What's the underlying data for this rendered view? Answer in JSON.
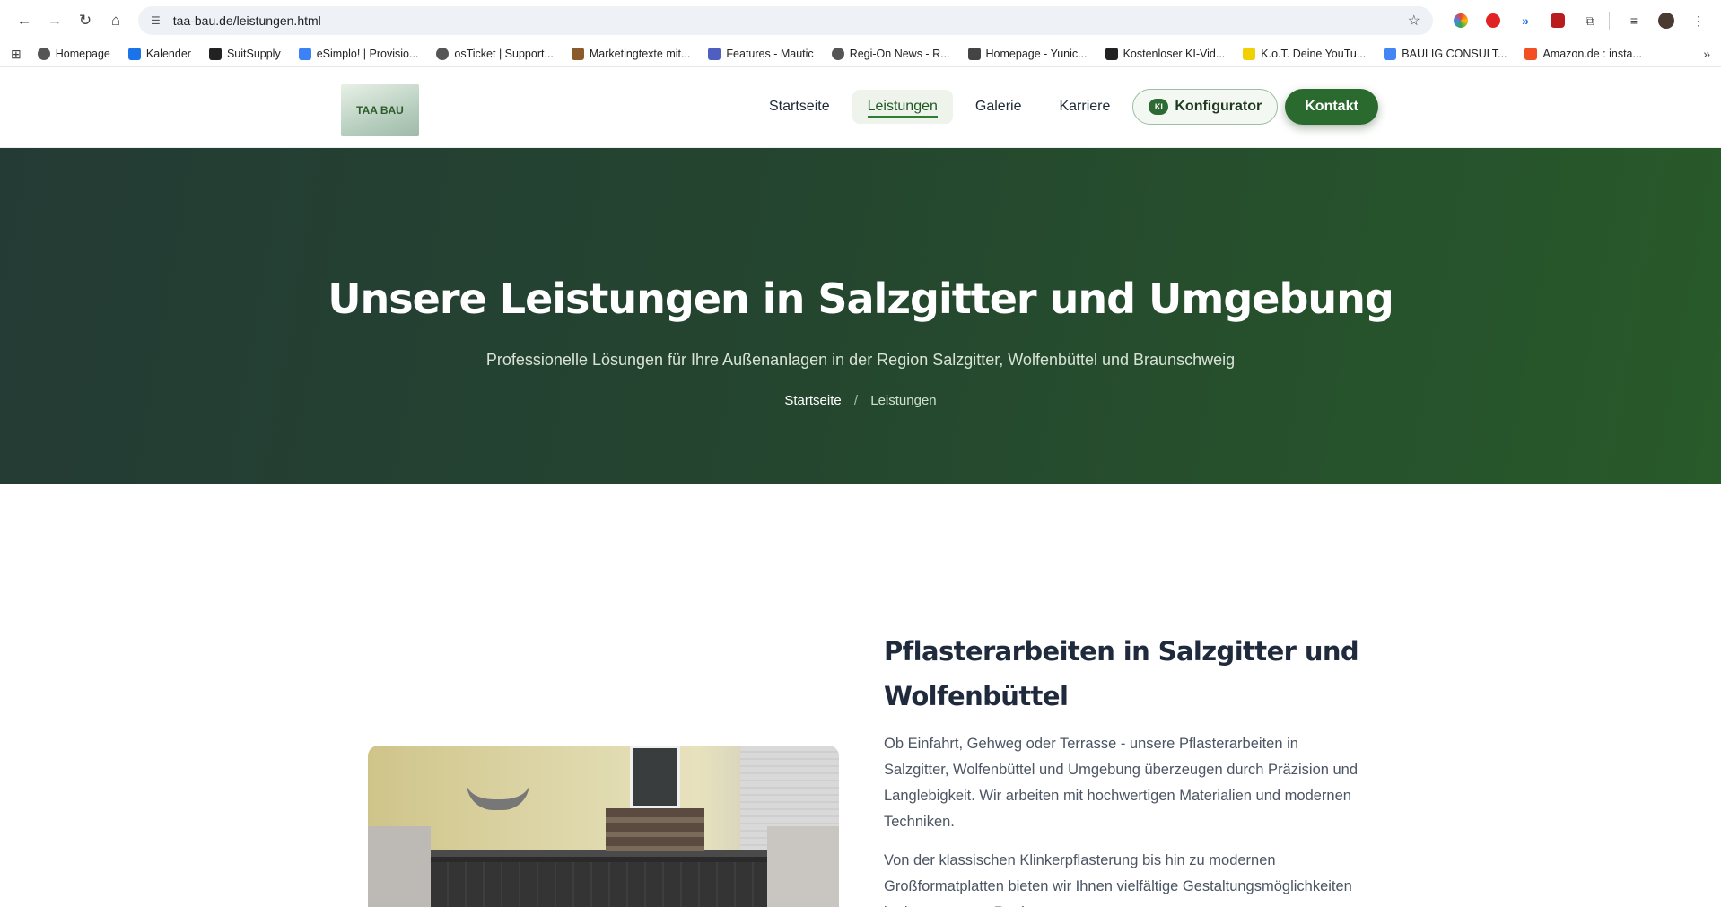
{
  "browser": {
    "url": "taa-bau.de/leistungen.html",
    "bookmarks": [
      {
        "label": "Homepage",
        "color": "#555555"
      },
      {
        "label": "Kalender",
        "color": "#1a73e8"
      },
      {
        "label": "SuitSupply",
        "color": "#222222"
      },
      {
        "label": "eSimplo! | Provisio...",
        "color": "#3b82f6"
      },
      {
        "label": "osTicket | Support...",
        "color": "#555555"
      },
      {
        "label": "Marketingtexte mit...",
        "color": "#8b5a2b"
      },
      {
        "label": "Features - Mautic",
        "color": "#4e5fbf"
      },
      {
        "label": "Regi-On News - R...",
        "color": "#555555"
      },
      {
        "label": "Homepage - Yunic...",
        "color": "#444444"
      },
      {
        "label": "Kostenloser KI-Vid...",
        "color": "#222222"
      },
      {
        "label": "K.o.T. Deine YouTu...",
        "color": "#f0d000"
      },
      {
        "label": "BAULIG CONSULT...",
        "color": "#4285f4"
      },
      {
        "label": "Amazon.de : insta...",
        "color": "#f25022"
      }
    ]
  },
  "header": {
    "logo_text": "TAA BAU",
    "nav": [
      {
        "label": "Startseite",
        "active": false
      },
      {
        "label": "Leistungen",
        "active": true
      },
      {
        "label": "Galerie",
        "active": false
      },
      {
        "label": "Karriere",
        "active": false
      }
    ],
    "konfigurator": {
      "badge": "KI",
      "label": "Konfigurator"
    },
    "kontakt_label": "Kontakt"
  },
  "hero": {
    "title": "Unsere Leistungen in Salzgitter und Umgebung",
    "subtitle": "Professionelle Lösungen für Ihre Außenanlagen in der Region Salzgitter, Wolfenbüttel und Braunschweig",
    "breadcrumb": {
      "home": "Startseite",
      "separator": "/",
      "current": "Leistungen"
    }
  },
  "section": {
    "title_line1": "Pflasterarbeiten in Salzgitter und",
    "title_line2": "Wolfenbüttel",
    "paragraph1": "Ob Einfahrt, Gehweg oder Terrasse - unsere Pflasterarbeiten in Salzgitter, Wolfenbüttel und Umgebung überzeugen durch Präzision und Langlebigkeit. Wir arbeiten mit hochwertigen Materialien und modernen Techniken.",
    "paragraph2": "Von der klassischen Klinkerpflasterung bis hin zu modernen Großformatplatten bieten wir Ihnen vielfältige Gestaltungsmöglichkeiten in der gesamten Region."
  }
}
